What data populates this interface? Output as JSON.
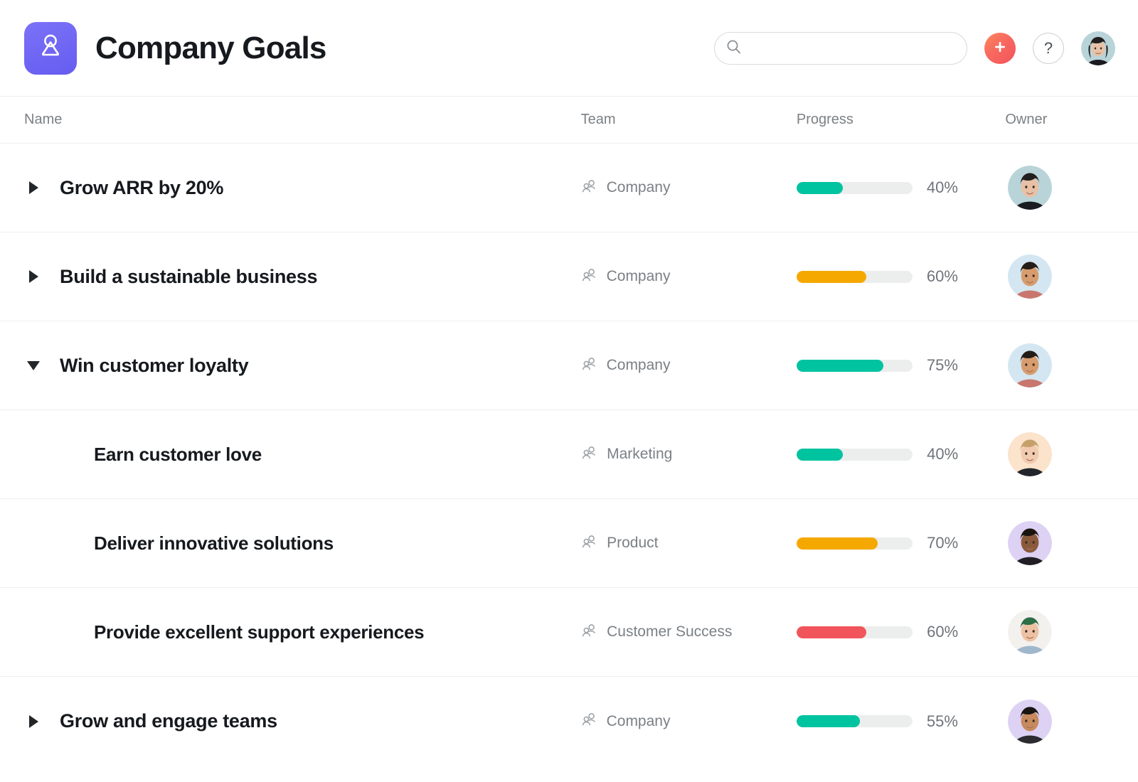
{
  "header": {
    "title": "Company Goals",
    "logo_icon": "goal-person-icon",
    "logo_color": "#6c63f5",
    "search": {
      "value": "",
      "placeholder": "",
      "icon": "search-icon"
    },
    "add_button": {
      "icon": "plus-icon",
      "label": "",
      "color": "#f2545b"
    },
    "help_button": {
      "icon": "question-mark-icon",
      "label": "?"
    },
    "user_avatar": {
      "name": "avatar",
      "bg": "#b9d4d8",
      "hair": "#20201f",
      "skin": "#e6bfa5",
      "clothes": "#1b1b22"
    }
  },
  "table": {
    "columns": [
      {
        "key": "name",
        "label": "Name"
      },
      {
        "key": "team",
        "label": "Team"
      },
      {
        "key": "progress",
        "label": "Progress"
      },
      {
        "key": "owner",
        "label": "Owner"
      }
    ],
    "rows": [
      {
        "name": "Grow ARR by 20%",
        "team": "Company",
        "team_icon": "people-icon",
        "progress": "40%",
        "progress_value": 40,
        "progress_color": "#00c3a0",
        "level": 0,
        "expanded": false,
        "has_children": true,
        "owner": {
          "bg": "#b9d4d8",
          "hair": "#221f1e",
          "skin": "#e8c0a6",
          "clothes": "#1b1b22"
        }
      },
      {
        "name": "Build a sustainable business",
        "team": "Company",
        "team_icon": "people-icon",
        "progress": "60%",
        "progress_value": 60,
        "progress_color": "#f5a800",
        "level": 0,
        "expanded": false,
        "has_children": true,
        "owner": {
          "bg": "#d4e6f1",
          "hair": "#241c16",
          "skin": "#d79c6e",
          "clothes": "#c9776e"
        }
      },
      {
        "name": "Win customer loyalty",
        "team": "Company",
        "team_icon": "people-icon",
        "progress": "75%",
        "progress_value": 75,
        "progress_color": "#00c3a0",
        "level": 0,
        "expanded": true,
        "has_children": true,
        "owner": {
          "bg": "#d4e6f1",
          "hair": "#241c16",
          "skin": "#d79c6e",
          "clothes": "#c9776e"
        }
      },
      {
        "name": "Earn customer love",
        "team": "Marketing",
        "team_icon": "people-icon",
        "progress": "40%",
        "progress_value": 40,
        "progress_color": "#00c3a0",
        "level": 1,
        "expanded": false,
        "has_children": false,
        "owner": {
          "bg": "#fbe3cc",
          "hair": "#c6a06a",
          "skin": "#f0cbb0",
          "clothes": "#22252b"
        }
      },
      {
        "name": "Deliver innovative solutions",
        "team": "Product",
        "team_icon": "people-icon",
        "progress": "70%",
        "progress_value": 70,
        "progress_color": "#f5a800",
        "level": 1,
        "expanded": false,
        "has_children": false,
        "owner": {
          "bg": "#ddd2f3",
          "hair": "#1a1411",
          "skin": "#8a5a3c",
          "clothes": "#211f25"
        }
      },
      {
        "name": "Provide excellent support experiences",
        "team": "Customer Success",
        "team_icon": "people-icon",
        "progress": "60%",
        "progress_value": 60,
        "progress_color": "#f2545b",
        "level": 1,
        "expanded": false,
        "has_children": false,
        "owner": {
          "bg": "#f3f1ee",
          "hair": "#2d6e46",
          "skin": "#edc2a4",
          "clothes": "#9fb7cc"
        }
      },
      {
        "name": "Grow and engage teams",
        "team": "Company",
        "team_icon": "people-icon",
        "progress": "55%",
        "progress_value": 55,
        "progress_color": "#00c3a0",
        "level": 0,
        "expanded": false,
        "has_children": true,
        "owner": {
          "bg": "#ddd2f3",
          "hair": "#181512",
          "skin": "#c68a5e",
          "clothes": "#2b2b30"
        }
      }
    ]
  }
}
